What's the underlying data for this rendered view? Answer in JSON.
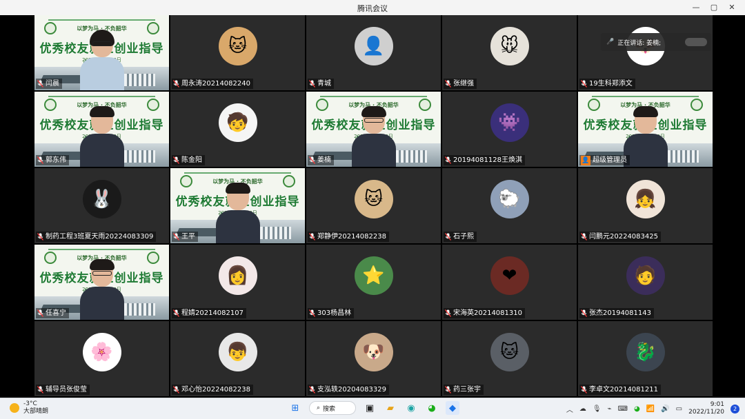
{
  "window": {
    "title": "腾讯会议",
    "controls": [
      "—",
      "▢",
      "✕"
    ]
  },
  "speaking": {
    "label": "正在讲话: 姜楠;"
  },
  "banner": {
    "slogan": "以梦为马 · 不负韶华",
    "headline": "优秀校友就业创业指导报告会",
    "date": "2022年11月20日"
  },
  "tiles": [
    {
      "name": "闫晨",
      "kind": "banner",
      "person": "woman"
    },
    {
      "name": "周永涛20214082240",
      "kind": "avatar",
      "emoji": "🐱",
      "bg": "#d9a86a"
    },
    {
      "name": "青城",
      "kind": "avatar",
      "emoji": "👤",
      "bg": "#cfcfcf"
    },
    {
      "name": "张继强",
      "kind": "avatar",
      "emoji": "🐭",
      "bg": "#e6e2da"
    },
    {
      "name": "19生科郑添文",
      "kind": "avatar",
      "emoji": "🐶",
      "bg": "#ffffff"
    },
    {
      "name": "郭东伟",
      "kind": "banner",
      "person": "man"
    },
    {
      "name": "陈金阳",
      "kind": "avatar",
      "emoji": "🧒",
      "bg": "#f5f5f5"
    },
    {
      "name": "姜楠",
      "kind": "banner",
      "person": "man-glasses",
      "active": true
    },
    {
      "name": "20194081128王焕淇",
      "kind": "avatar",
      "emoji": "👾",
      "bg": "#3a2f7a"
    },
    {
      "name": "超级管理员",
      "kind": "banner",
      "person": "man",
      "host": true
    },
    {
      "name": "制药工程3班夏天雨20224083309",
      "kind": "avatar",
      "emoji": "🐰",
      "bg": "#1a1a1a"
    },
    {
      "name": "王平",
      "kind": "banner",
      "person": "man"
    },
    {
      "name": "郑静伊20214082238",
      "kind": "avatar",
      "emoji": "🐱",
      "bg": "#d8b88a"
    },
    {
      "name": "石子熙",
      "kind": "avatar",
      "emoji": "🐑",
      "bg": "#8fa0b8"
    },
    {
      "name": "闫鹏元20224083425",
      "kind": "avatar",
      "emoji": "👧",
      "bg": "#f0e4d8"
    },
    {
      "name": "任喜宁",
      "kind": "banner",
      "person": "man-glasses"
    },
    {
      "name": "程婧20214082107",
      "kind": "avatar",
      "emoji": "👩",
      "bg": "#f3e8e8"
    },
    {
      "name": "303杨昌林",
      "kind": "avatar",
      "emoji": "⭐",
      "bg": "#4a8a4a"
    },
    {
      "name": "宋海英20214081310",
      "kind": "avatar",
      "emoji": "❤",
      "bg": "#6b2a24"
    },
    {
      "name": "张杰20194081143",
      "kind": "avatar",
      "emoji": "🧑",
      "bg": "#3b2d5a"
    },
    {
      "name": "辅导员张俊莹",
      "kind": "avatar",
      "emoji": "🌸",
      "bg": "#ffffff"
    },
    {
      "name": "邓心怡20224082238",
      "kind": "avatar",
      "emoji": "👦",
      "bg": "#e8e8e8"
    },
    {
      "name": "支泓轶20204083329",
      "kind": "avatar",
      "emoji": "🐶",
      "bg": "#c9a98a"
    },
    {
      "name": "药三张宇",
      "kind": "avatar",
      "emoji": "🐱",
      "bg": "#5a5f66"
    },
    {
      "name": "李卓文20214081211",
      "kind": "avatar",
      "emoji": "🐉",
      "bg": "#3c4550"
    }
  ],
  "taskbar": {
    "weather_temp": "-3°C",
    "weather_desc": "大部晴朗",
    "search_label": "搜索",
    "time": "9:01",
    "date": "2022/11/20",
    "notifications": "2"
  }
}
